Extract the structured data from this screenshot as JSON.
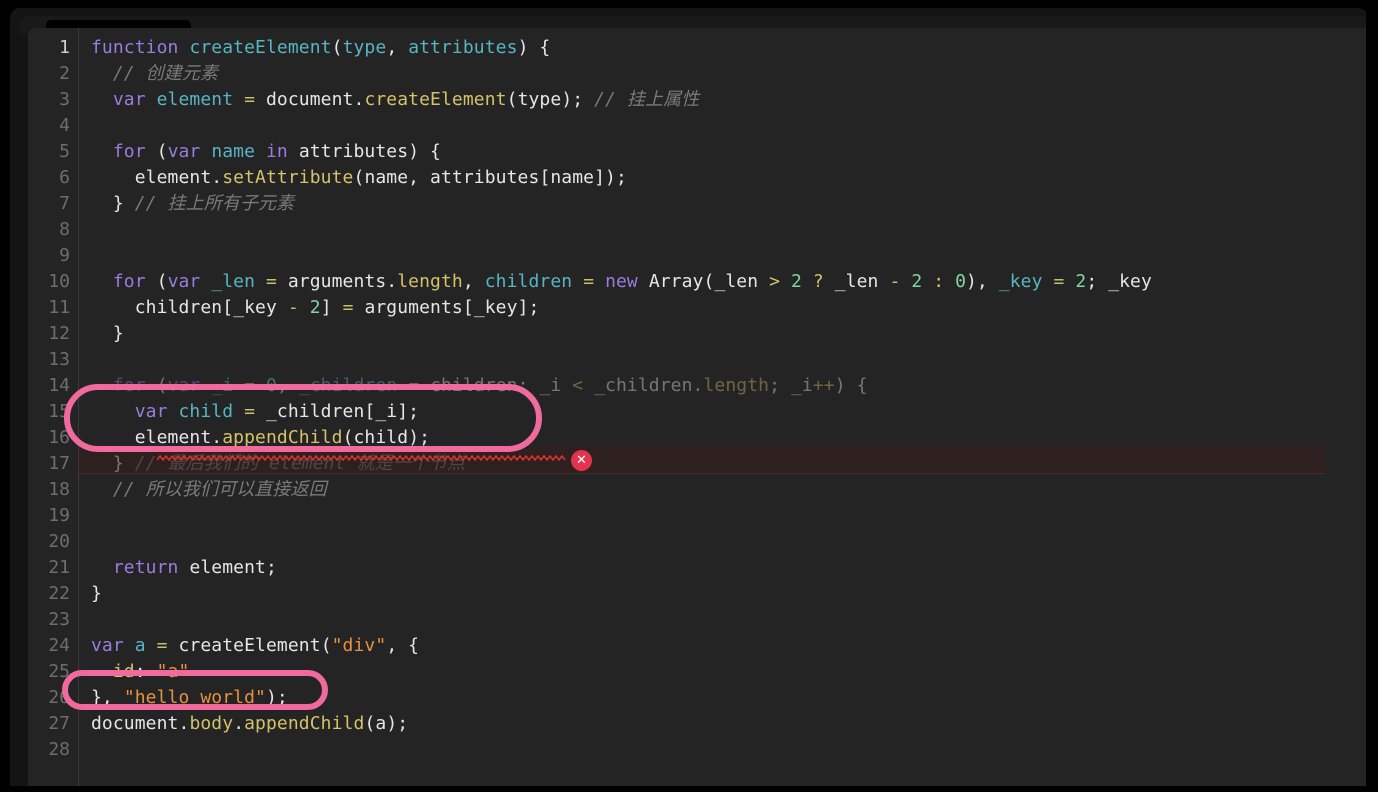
{
  "window": {
    "kind": "code-editor",
    "background": "#242424",
    "chrome_background": "#000000"
  },
  "editor": {
    "language": "javascript",
    "active_line": 1,
    "error_line": 16,
    "total_lines": 28,
    "line_numbers": [
      "1",
      "2",
      "3",
      "4",
      "5",
      "6",
      "7",
      "8",
      "9",
      "10",
      "11",
      "12",
      "13",
      "14",
      "15",
      "16",
      "17",
      "18",
      "19",
      "20",
      "21",
      "22",
      "23",
      "24",
      "25",
      "26",
      "27",
      "28"
    ]
  },
  "code": {
    "lines": [
      {
        "n": 1,
        "text": "function createElement(type, attributes) {"
      },
      {
        "n": 2,
        "text": "  // 创建元素"
      },
      {
        "n": 3,
        "text": "  var element = document.createElement(type); // 挂上属性"
      },
      {
        "n": 4,
        "text": ""
      },
      {
        "n": 5,
        "text": "  for (var name in attributes) {"
      },
      {
        "n": 6,
        "text": "    element.setAttribute(name, attributes[name]);"
      },
      {
        "n": 7,
        "text": "  } // 挂上所有子元素"
      },
      {
        "n": 8,
        "text": ""
      },
      {
        "n": 9,
        "text": ""
      },
      {
        "n": 10,
        "text": "  for (var _len = arguments.length, children = new Array(_len > 2 ? _len - 2 : 0), _key = 2; _key"
      },
      {
        "n": 11,
        "text": "    children[_key - 2] = arguments[_key];"
      },
      {
        "n": 12,
        "text": "  }"
      },
      {
        "n": 13,
        "text": ""
      },
      {
        "n": 14,
        "text": "  for (var _i = 0, _children = children; _i < _children.length; _i++) {"
      },
      {
        "n": 15,
        "text": "    var child = _children[_i];"
      },
      {
        "n": 16,
        "text": "    element.appendChild(child);"
      },
      {
        "n": 17,
        "text": "  } // 最后我们的 element 就是一个节点"
      },
      {
        "n": 18,
        "text": "  // 所以我们可以直接返回"
      },
      {
        "n": 19,
        "text": ""
      },
      {
        "n": 20,
        "text": ""
      },
      {
        "n": 21,
        "text": "  return element;"
      },
      {
        "n": 22,
        "text": "}"
      },
      {
        "n": 23,
        "text": ""
      },
      {
        "n": 24,
        "text": "var a = createElement(\"div\", {"
      },
      {
        "n": 25,
        "text": "  id: \"a\""
      },
      {
        "n": 26,
        "text": "}, \"hello world\");"
      },
      {
        "n": 27,
        "text": "document.body.appendChild(a);"
      },
      {
        "n": 28,
        "text": ""
      }
    ]
  },
  "diagnostics": {
    "error_badge_glyph": "✕",
    "error_badge_color": "#e3344f",
    "error_line": 16,
    "squiggle_color": "#e03030"
  },
  "annotations": {
    "highlight_color": "#f06a9e",
    "ellipses": [
      {
        "id": "ring-1",
        "covers_lines": "15-16",
        "label": "var child = _children[_i]; element.appendChild(child);"
      },
      {
        "id": "ring-2",
        "covers_lines": "26",
        "label": "}, \"hello world\");"
      }
    ]
  },
  "theme": {
    "keyword": "#9a7ce0",
    "identifier": "#56b6c2",
    "method": "#d6c26a",
    "operator": "#c9c06a",
    "number": "#7fd6a0",
    "string": "#e8923f",
    "comment": "#7a7a7a",
    "plain": "#e6e6e6",
    "gutter_text": "#6e6e6e",
    "gutter_active": "#d0d0d0",
    "error_line_bg": "#2f2020"
  }
}
